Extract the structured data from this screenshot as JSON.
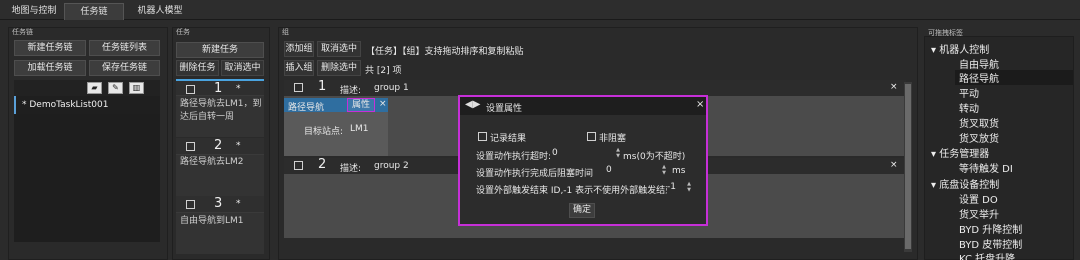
{
  "tabs": [
    "地图与控制",
    "任务链",
    "机器人模型"
  ],
  "chain_panel": {
    "title": "任务链",
    "buttons": [
      "新建任务链",
      "任务链列表",
      "加载任务链",
      "保存任务链"
    ],
    "items": [
      "* DemoTaskList001"
    ]
  },
  "task_panel": {
    "title": "任务",
    "buttons": [
      "新建任务",
      "删除任务",
      "取消选中"
    ],
    "tasks": [
      {
        "num": "1",
        "mark": "*",
        "desc": "路径导航去LM1，到达后自转一周"
      },
      {
        "num": "2",
        "mark": "*",
        "desc": "路径导航去LM2"
      },
      {
        "num": "3",
        "mark": "*",
        "desc": "自由导航到LM1"
      }
    ]
  },
  "group_panel": {
    "title": "组",
    "buttons_row1": [
      "添加组",
      "取消选中"
    ],
    "hint": "【任务】【组】支持拖动排序和复制粘贴",
    "buttons_row2": [
      "插入组",
      "删除选中"
    ],
    "count": "共 [2] 项",
    "groups": [
      {
        "num": "1",
        "label": "描述:",
        "value": "group 1",
        "close": "×"
      },
      {
        "num": "2",
        "label": "描述:",
        "value": "group 2",
        "close": "×"
      }
    ],
    "action": {
      "name": "路径导航",
      "attr_button": "属性",
      "close": "×",
      "station_label": "目标站点:",
      "station_value": "LM1"
    }
  },
  "dialog": {
    "title": "设置属性",
    "close": "×",
    "record_result": "记录结果",
    "non_blocking": "非阻塞",
    "timeout_label": "设置动作执行超时:",
    "timeout_value": "0",
    "timeout_unit": "ms(0为不超时)",
    "block_label": "设置动作执行完成后阻塞时间",
    "block_value": "0",
    "block_unit": "ms",
    "trigger_label": "设置外部触发结束 ID,-1 表示不使用外部触发结束",
    "trigger_value": "-1",
    "ok": "确定"
  },
  "tree": {
    "title": "可拖拽标签",
    "groups": [
      {
        "label": "机器人控制",
        "items": [
          "自由导航",
          "路径导航",
          "平动",
          "转动",
          "货叉取货",
          "货叉放货"
        ]
      },
      {
        "label": "任务管理器",
        "items": [
          "等待触发 DI"
        ]
      },
      {
        "label": "底盘设备控制",
        "items": [
          "设置 DO",
          "货叉举升",
          "BYD 升降控制",
          "BYD 皮带控制",
          "KC 托盘升降"
        ]
      }
    ],
    "selected": "路径导航"
  },
  "colors": {
    "accent_magenta": "#c62fd8",
    "hint_magenta": "#e0429a",
    "select_blue": "#4aa3df",
    "background": "#2b2b2b"
  }
}
